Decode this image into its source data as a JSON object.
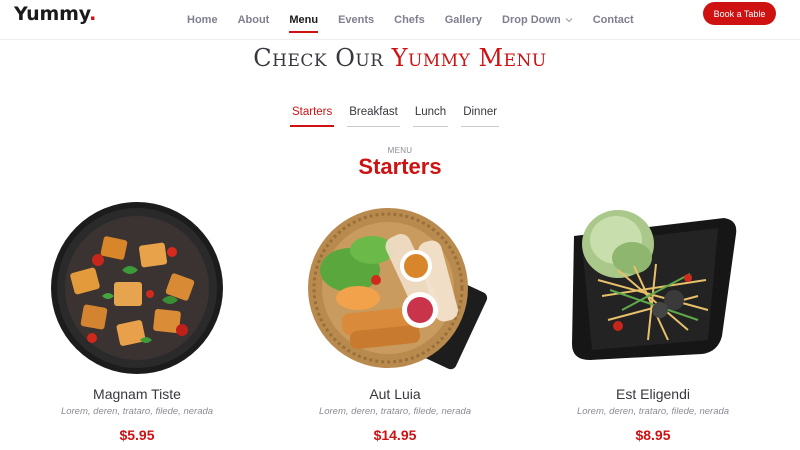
{
  "brand": {
    "name": "Yummy",
    "dot": "."
  },
  "nav": {
    "items": [
      {
        "label": "Home"
      },
      {
        "label": "About"
      },
      {
        "label": "Menu"
      },
      {
        "label": "Events"
      },
      {
        "label": "Chefs"
      },
      {
        "label": "Gallery"
      },
      {
        "label": "Drop Down"
      },
      {
        "label": "Contact"
      }
    ],
    "active": "Menu",
    "cta": "Book a Table"
  },
  "section": {
    "title_prefix": "Check Our",
    "title_highlight": "Yummy Menu",
    "eyebrow": "MENU",
    "heading": "Starters"
  },
  "tabs": [
    {
      "label": "Starters",
      "active": true
    },
    {
      "label": "Breakfast"
    },
    {
      "label": "Lunch"
    },
    {
      "label": "Dinner"
    }
  ],
  "items": [
    {
      "name": "Magnam Tiste",
      "desc": "Lorem, deren, trataro, filede, nerada",
      "price": "$5.95"
    },
    {
      "name": "Aut Luia",
      "desc": "Lorem, deren, trataro, filede, nerada",
      "price": "$14.95"
    },
    {
      "name": "Est Eligendi",
      "desc": "Lorem, deren, trataro, filede, nerada",
      "price": "$8.95"
    }
  ],
  "colors": {
    "accent": "#ce1212",
    "text": "#37373f",
    "muted": "#8b8b96"
  },
  "icons": {
    "dropdown": "chevron-down-icon"
  }
}
